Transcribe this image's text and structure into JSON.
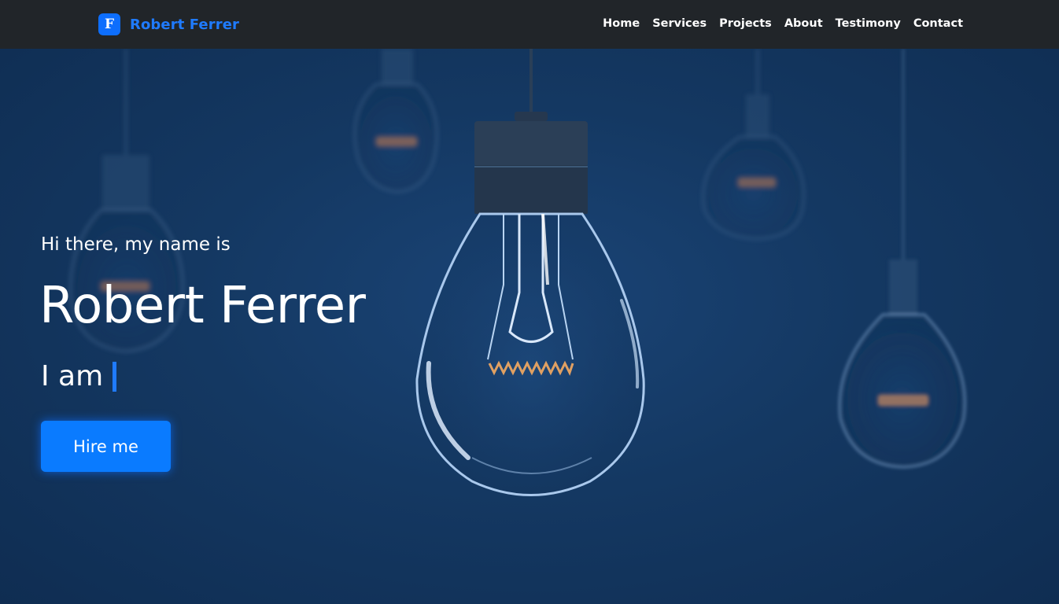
{
  "brand": {
    "logo_letter": "F",
    "name": "Robert Ferrer"
  },
  "nav": {
    "items": [
      {
        "label": "Home"
      },
      {
        "label": "Services"
      },
      {
        "label": "Projects"
      },
      {
        "label": "About"
      },
      {
        "label": "Testimony"
      },
      {
        "label": "Contact"
      }
    ]
  },
  "hero": {
    "greeting": "Hi there, my name is",
    "name": "Robert Ferrer",
    "role_prefix": "I am",
    "button_label": "Hire me",
    "background_image": "light-bulbs-icon"
  },
  "colors": {
    "navbar_bg": "#212529",
    "brand_accent": "#1f7bff",
    "button_bg": "#0a7bff",
    "hero_bg": "#12325a"
  }
}
